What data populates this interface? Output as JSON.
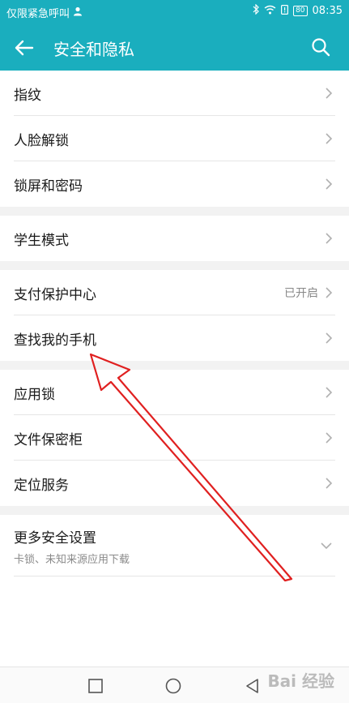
{
  "status_bar": {
    "carrier": "仅限紧急呼叫",
    "battery": "80",
    "time": "08:35"
  },
  "app_bar": {
    "title": "安全和隐私"
  },
  "groups": [
    {
      "items": [
        {
          "label": "指纹"
        },
        {
          "label": "人脸解锁"
        },
        {
          "label": "锁屏和密码"
        }
      ]
    },
    {
      "items": [
        {
          "label": "学生模式"
        }
      ]
    },
    {
      "items": [
        {
          "label": "支付保护中心",
          "status": "已开启"
        },
        {
          "label": "查找我的手机"
        }
      ]
    },
    {
      "items": [
        {
          "label": "应用锁"
        },
        {
          "label": "文件保密柜"
        },
        {
          "label": "定位服务"
        }
      ]
    }
  ],
  "more": {
    "label": "更多安全设置",
    "sub": "卡锁、未知来源应用下载"
  },
  "watermark": "Bai 经验",
  "colors": {
    "accent": "#1aaebe",
    "annotation": "#e02020"
  }
}
